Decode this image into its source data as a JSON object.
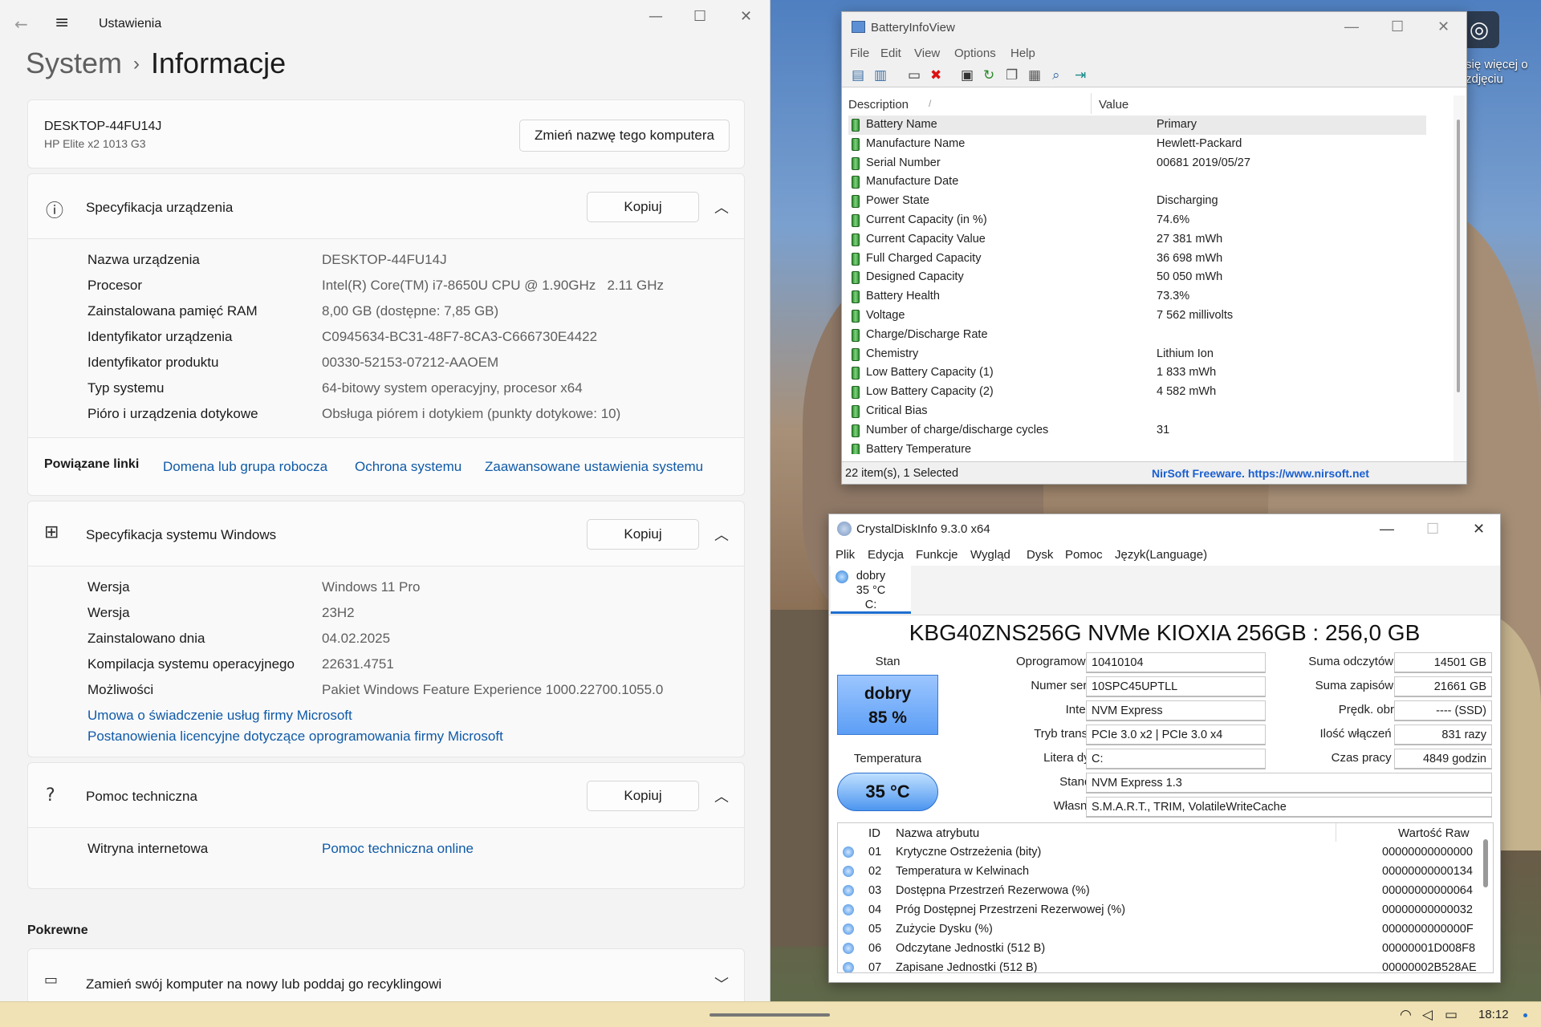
{
  "settings": {
    "app_title": "Ustawienia",
    "breadcrumb_parent": "System",
    "breadcrumb_sep": "›",
    "breadcrumb_current": "Informacje",
    "device_name": "DESKTOP-44FU14J",
    "device_model": "HP Elite x2 1013 G3",
    "rename_button": "Zmień nazwę tego komputera",
    "device_spec": {
      "title": "Specyfikacja urządzenia",
      "copy": "Kopiuj",
      "rows": [
        {
          "label": "Nazwa urządzenia",
          "value": "DESKTOP-44FU14J"
        },
        {
          "label": "Procesor",
          "value": "Intel(R) Core(TM) i7-8650U CPU @ 1.90GHz   2.11 GHz"
        },
        {
          "label": "Zainstalowana pamięć RAM",
          "value": "8,00 GB (dostępne: 7,85 GB)"
        },
        {
          "label": "Identyfikator urządzenia",
          "value": "C0945634-BC31-48F7-8CA3-C666730E4422"
        },
        {
          "label": "Identyfikator produktu",
          "value": "00330-52153-07212-AAOEM"
        },
        {
          "label": "Typ systemu",
          "value": "64-bitowy system operacyjny, procesor x64"
        },
        {
          "label": "Pióro i urządzenia dotykowe",
          "value": "Obsługa piórem i dotykiem (punkty dotykowe: 10)"
        }
      ]
    },
    "related": {
      "title": "Powiązane linki",
      "links": [
        "Domena lub grupa robocza",
        "Ochrona systemu",
        "Zaawansowane ustawienia systemu"
      ]
    },
    "windows_spec": {
      "title": "Specyfikacja systemu Windows",
      "copy": "Kopiuj",
      "rows": [
        {
          "label": "Wersja",
          "value": "Windows 11 Pro"
        },
        {
          "label": "Wersja",
          "value": "23H2"
        },
        {
          "label": "Zainstalowano dnia",
          "value": "04.02.2025"
        },
        {
          "label": "Kompilacja systemu operacyjnego",
          "value": "22631.4751"
        },
        {
          "label": "Możliwości",
          "value": "Pakiet Windows Feature Experience 1000.22700.1055.0"
        }
      ],
      "links": [
        "Umowa o świadczenie usług firmy Microsoft",
        "Postanowienia licencyjne dotyczące oprogramowania firmy Microsoft"
      ]
    },
    "support": {
      "title": "Pomoc techniczna",
      "copy": "Kopiuj",
      "label": "Witryna internetowa",
      "link": "Pomoc techniczna online"
    },
    "related_section": "Pokrewne",
    "recycle": "Zamień swój komputer na nowy lub poddaj go recyklingowi"
  },
  "battery": {
    "title": "BatteryInfoView",
    "menu": [
      "File",
      "Edit",
      "View",
      "Options",
      "Help"
    ],
    "col_description": "Description",
    "col_value": "Value",
    "rows": [
      {
        "d": "Battery Name",
        "v": "Primary"
      },
      {
        "d": "Manufacture Name",
        "v": "Hewlett-Packard"
      },
      {
        "d": "Serial Number",
        "v": "00681 2019/05/27"
      },
      {
        "d": "Manufacture Date",
        "v": ""
      },
      {
        "d": "Power State",
        "v": "Discharging"
      },
      {
        "d": "Current Capacity (in %)",
        "v": "74.6%"
      },
      {
        "d": "Current Capacity Value",
        "v": "27 381 mWh"
      },
      {
        "d": "Full Charged Capacity",
        "v": "36 698 mWh"
      },
      {
        "d": "Designed Capacity",
        "v": "50 050 mWh"
      },
      {
        "d": "Battery Health",
        "v": "73.3%"
      },
      {
        "d": "Voltage",
        "v": "7 562 millivolts"
      },
      {
        "d": "Charge/Discharge Rate",
        "v": ""
      },
      {
        "d": "Chemistry",
        "v": "Lithium Ion"
      },
      {
        "d": "Low Battery Capacity (1)",
        "v": "1 833 mWh"
      },
      {
        "d": "Low Battery Capacity (2)",
        "v": "4 582 mWh"
      },
      {
        "d": "Critical Bias",
        "v": ""
      },
      {
        "d": "Number of charge/discharge cycles",
        "v": "31"
      },
      {
        "d": "Battery Temperature",
        "v": ""
      }
    ],
    "status_count": "22 item(s), 1 Selected",
    "status_link": "NirSoft Freeware. https://www.nirsoft.net"
  },
  "crystal": {
    "title": "CrystalDiskInfo 9.3.0 x64",
    "menu": [
      "Plik",
      "Edycja",
      "Funkcje",
      "Wygląd",
      "Dysk",
      "Pomoc",
      "Język(Language)"
    ],
    "tab_status": "dobry",
    "tab_temp": "35 °C",
    "tab_drive": "C:",
    "model": "KBG40ZNS256G NVMe KIOXIA 256GB : 256,0 GB",
    "stan_label": "Stan",
    "health_word": "dobry",
    "health_pct": "85 %",
    "temp_label": "Temperatura",
    "temp_value": "35 °C",
    "left_fields": [
      {
        "label": "Oprogramowanie",
        "value": "10410104"
      },
      {
        "label": "Numer seryjny",
        "value": "10SPC45UPTLL"
      },
      {
        "label": "Interfejs",
        "value": "NVM Express"
      },
      {
        "label": "Tryb transferu",
        "value": "PCIe 3.0 x2 | PCIe 3.0 x4"
      },
      {
        "label": "Litera dysku",
        "value": "C:"
      }
    ],
    "right_fields": [
      {
        "label": "Suma odczytów hosta",
        "value": "14501 GB"
      },
      {
        "label": "Suma zapisów hosta",
        "value": "21661 GB"
      },
      {
        "label": "Prędk. obrotowa",
        "value": "---- (SSD)"
      },
      {
        "label": "Ilość włączeń dysku",
        "value": "831 razy"
      },
      {
        "label": "Czas pracy dysku",
        "value": "4849 godzin"
      }
    ],
    "standard_label": "Standard",
    "standard_value": "NVM Express 1.3",
    "features_label": "Własności",
    "features_value": "S.M.A.R.T., TRIM, VolatileWriteCache",
    "table_headers": {
      "id": "ID",
      "name": "Nazwa atrybutu",
      "raw": "Wartość Raw"
    },
    "attributes": [
      {
        "id": "01",
        "name": "Krytyczne Ostrzeżenia (bity)",
        "raw": "00000000000000"
      },
      {
        "id": "02",
        "name": "Temperatura w Kelwinach",
        "raw": "00000000000134"
      },
      {
        "id": "03",
        "name": "Dostępna Przestrzeń Rezerwowa (%)",
        "raw": "00000000000064"
      },
      {
        "id": "04",
        "name": "Próg Dostępnej Przestrzeni Rezerwowej (%)",
        "raw": "00000000000032"
      },
      {
        "id": "05",
        "name": "Zużycie Dysku (%)",
        "raw": "0000000000000F"
      },
      {
        "id": "06",
        "name": "Odczytane Jednostki (512 B)",
        "raw": "00000001D008F8"
      },
      {
        "id": "07",
        "name": "Zapisane Jednostki (512 B)",
        "raw": "00000002B528AE"
      }
    ]
  },
  "desktop": {
    "hint": "się więcej o zdjęciu"
  },
  "taskbar": {
    "time": "18:12"
  }
}
